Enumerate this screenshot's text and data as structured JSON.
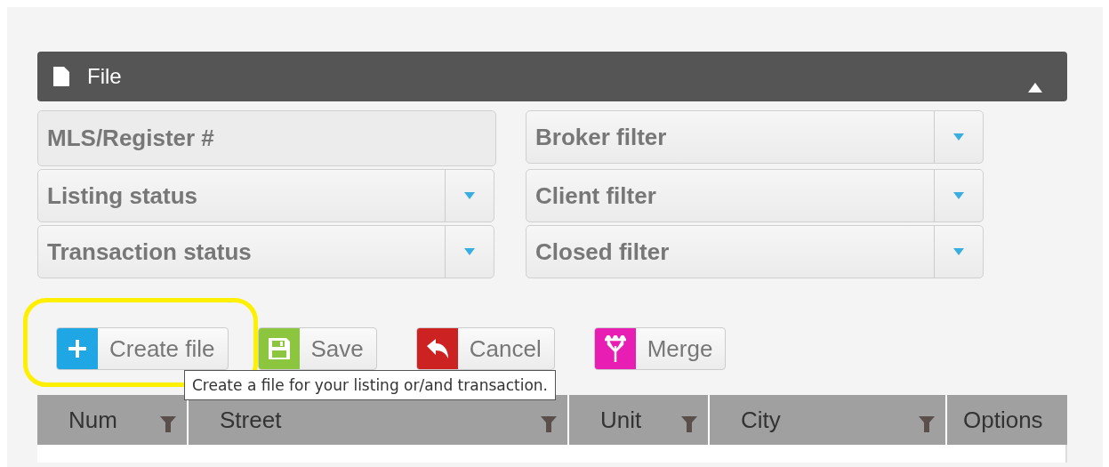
{
  "panel": {
    "title": "File",
    "expanded": true
  },
  "filters": [
    {
      "kind": "text",
      "placeholder": "MLS/Register #"
    },
    {
      "kind": "select",
      "placeholder": "Broker filter"
    },
    {
      "kind": "select",
      "placeholder": "Listing status"
    },
    {
      "kind": "select",
      "placeholder": "Client filter"
    },
    {
      "kind": "select",
      "placeholder": "Transaction status"
    },
    {
      "kind": "select",
      "placeholder": "Closed filter"
    }
  ],
  "buttons": [
    {
      "kind": "plus",
      "label": "Create file",
      "color": "#1ea7e4",
      "highlighted": true
    },
    {
      "kind": "save",
      "label": "Save",
      "color": "#8cc63f",
      "highlighted": false
    },
    {
      "kind": "undo",
      "label": "Cancel",
      "color": "#cc2222",
      "highlighted": false
    },
    {
      "kind": "merge",
      "label": "Merge",
      "color": "#e81eb4",
      "highlighted": false
    }
  ],
  "tooltip": "Create a file for your listing or/and transaction.",
  "table": {
    "columns": [
      {
        "label": "Num",
        "filterable": true
      },
      {
        "label": "Street",
        "filterable": true
      },
      {
        "label": "Unit",
        "filterable": true
      },
      {
        "label": "City",
        "filterable": true
      },
      {
        "label": "Options",
        "filterable": false
      }
    ]
  }
}
